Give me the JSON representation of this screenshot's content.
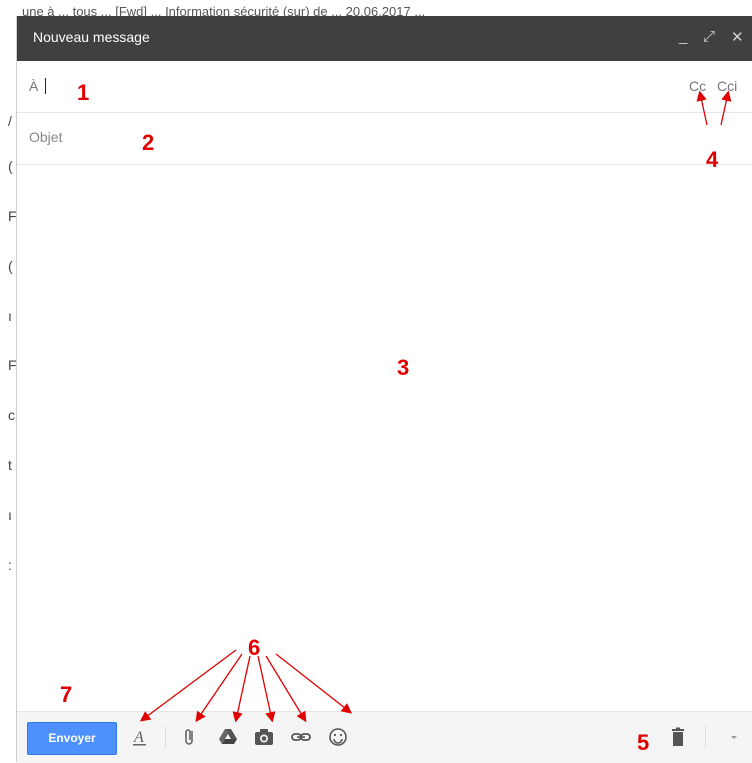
{
  "window": {
    "title": "Nouveau message",
    "controls": [
      "minimize-icon",
      "expand-icon",
      "close-icon"
    ]
  },
  "background": {
    "top_text": "une à ... tous ... [Fwd] ... Information sécurité (sur) de ... 20.06.2017 ..."
  },
  "to_field": {
    "label": "À",
    "cc_label": "Cc",
    "cci_label": "Cci"
  },
  "subject_field": {
    "placeholder": "Objet"
  },
  "toolbar": {
    "send_label": "Envoyer",
    "icons": [
      "text-format-icon",
      "attach-icon",
      "drive-icon",
      "photo-icon",
      "link-icon",
      "emoji-icon",
      "trash-icon",
      "more-options-icon"
    ]
  },
  "annotations": [
    "1",
    "2",
    "3",
    "4",
    "5",
    "6",
    "7"
  ],
  "colors": {
    "titlebar": "#404040",
    "send_button": "#4d90fe",
    "annotation": "#e00000"
  }
}
